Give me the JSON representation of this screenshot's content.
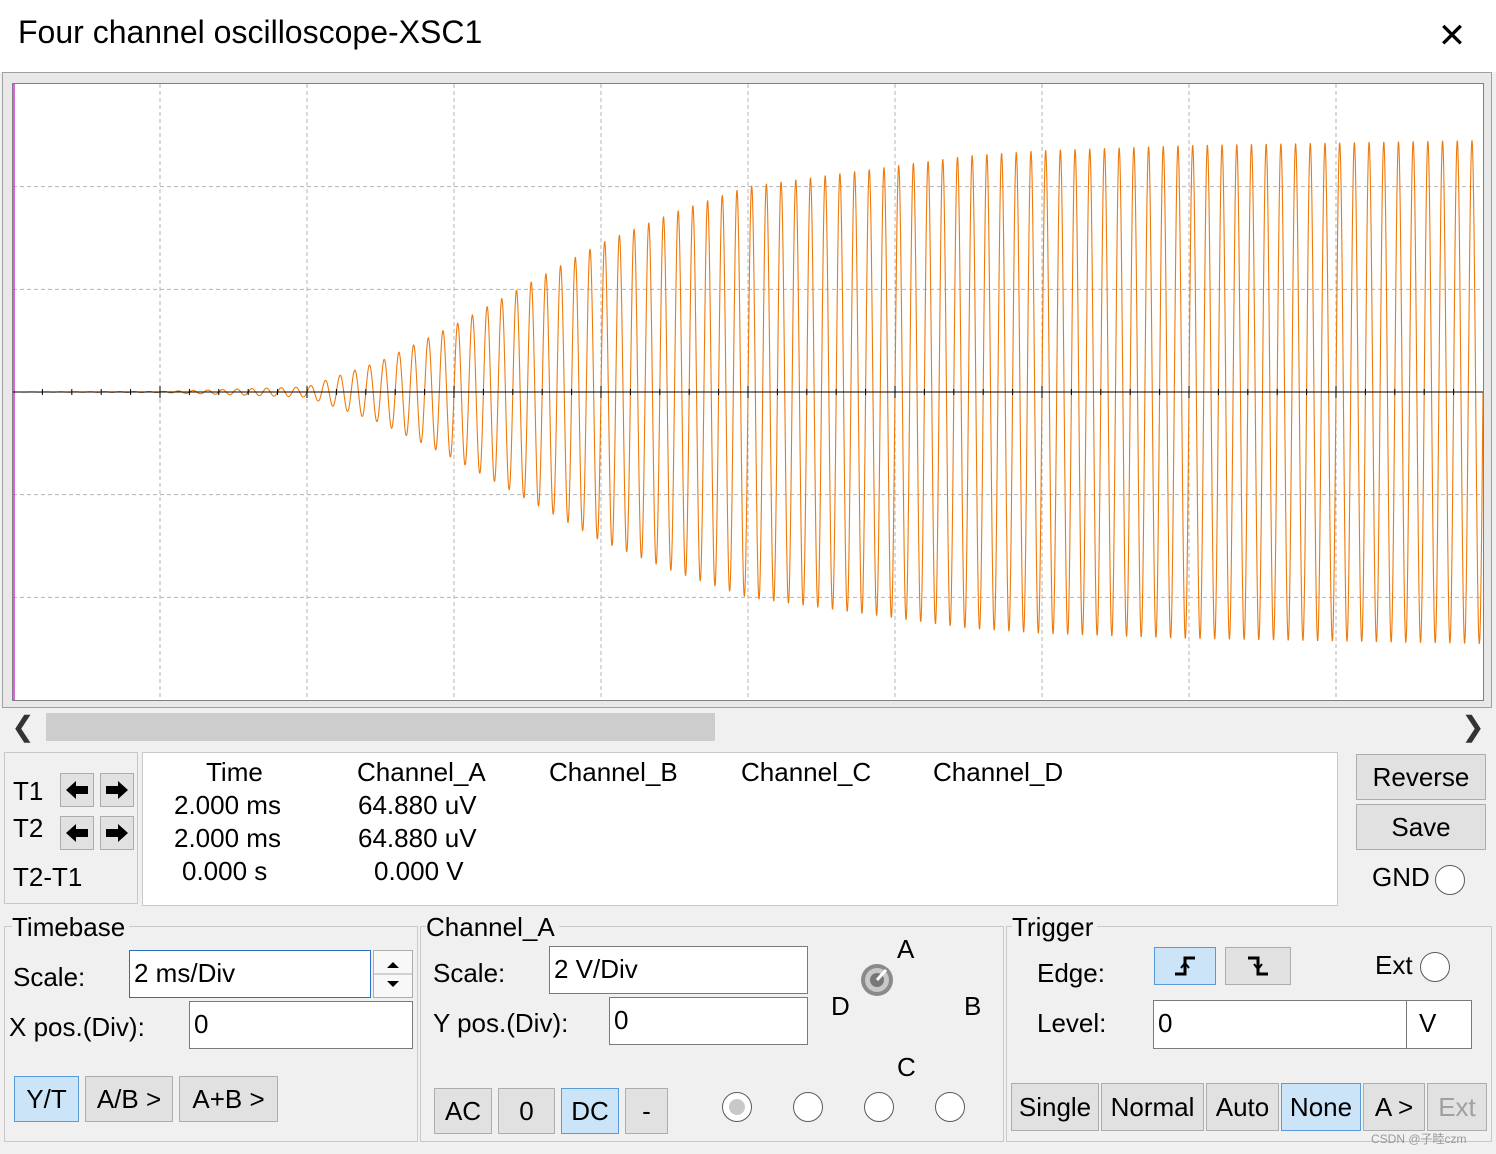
{
  "window": {
    "title": "Four channel oscilloscope-XSC1",
    "close_glyph": "✕"
  },
  "scrollbar": {
    "left_glyph": "❮",
    "right_glyph": "❯"
  },
  "cursors": {
    "t1_label": "T1",
    "t2_label": "T2",
    "diff_label": "T2-T1",
    "headers": [
      "Time",
      "Channel_A",
      "Channel_B",
      "Channel_C",
      "Channel_D"
    ],
    "t1": {
      "time": "2.000 ms",
      "channel_a": "64.880 uV"
    },
    "t2": {
      "time": "2.000 ms",
      "channel_a": "64.880 uV"
    },
    "diff": {
      "time": "0.000 s",
      "channel_a": "0.000 V"
    }
  },
  "side_buttons": {
    "reverse": "Reverse",
    "save": "Save",
    "gnd": "GND"
  },
  "timebase": {
    "title": "Timebase",
    "scale_label": "Scale:",
    "scale_value": "2 ms/Div",
    "xpos_label": "X pos.(Div):",
    "xpos_value": "0",
    "modes": [
      "Y/T",
      "A/B >",
      "A+B >"
    ],
    "active_mode": "Y/T"
  },
  "channel": {
    "title": "Channel_A",
    "scale_label": "Scale:",
    "scale_value": "2  V/Div",
    "ypos_label": "Y pos.(Div):",
    "ypos_value": "0",
    "coupling": [
      "AC",
      "0",
      "DC",
      "-"
    ],
    "active_coupling": "DC",
    "knob_labels": {
      "a": "A",
      "b": "B",
      "c": "C",
      "d": "D"
    }
  },
  "trigger": {
    "title": "Trigger",
    "edge_label": "Edge:",
    "level_label": "Level:",
    "level_value": "0",
    "level_unit": "V",
    "ext_label": "Ext",
    "modes": [
      "Single",
      "Normal",
      "Auto",
      "None",
      "A >",
      "Ext"
    ],
    "active_mode": "None"
  },
  "watermark": "CSDN @子睦czm",
  "colors": {
    "trace": "#ef7a0c",
    "grid": "#b4b4b4",
    "axis": "#000000",
    "cursor": "#cc33cc"
  },
  "chart_data": {
    "type": "line",
    "title": "",
    "xlabel": "",
    "ylabel": "",
    "divisions_x": 10,
    "divisions_y": 6,
    "x_unit": "ms",
    "y_unit": "V",
    "x_range": [
      0,
      20
    ],
    "ylim": [
      -6,
      6
    ],
    "series": [
      {
        "waveform": "sine",
        "frequency_hz": 5000,
        "envelope": {
          "t_ms": [
            0,
            2,
            4,
            5,
            6,
            7,
            8,
            9,
            10,
            11,
            12,
            13,
            14,
            16,
            18,
            20
          ],
          "amplitude_v": [
            0,
            0.01,
            0.1,
            0.6,
            1.3,
            2.1,
            2.9,
            3.5,
            4.0,
            4.2,
            4.4,
            4.6,
            4.7,
            4.8,
            4.85,
            4.9
          ]
        }
      }
    ]
  }
}
